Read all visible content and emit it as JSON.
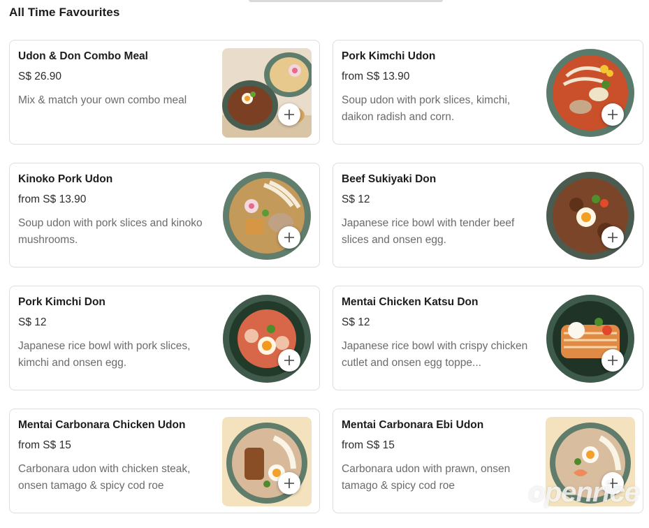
{
  "section": {
    "title": "All Time Favourites"
  },
  "items": [
    {
      "name": "Udon & Don Combo Meal",
      "price": "S$ 26.90",
      "description": "Mix & match your own combo meal",
      "image": "combo-meal-photo"
    },
    {
      "name": "Pork Kimchi Udon",
      "price": "from S$ 13.90",
      "description": "Soup udon with pork slices, kimchi, daikon radish and corn.",
      "image": "pork-kimchi-udon-photo"
    },
    {
      "name": "Kinoko Pork Udon",
      "price": "from S$ 13.90",
      "description": "Soup udon with pork slices and kinoko mushrooms.",
      "image": "kinoko-pork-udon-photo"
    },
    {
      "name": "Beef Sukiyaki Don",
      "price": "S$ 12",
      "description": "Japanese rice bowl with tender beef slices and onsen egg.",
      "image": "beef-sukiyaki-don-photo"
    },
    {
      "name": "Pork Kimchi Don",
      "price": "S$ 12",
      "description": "Japanese rice bowl with pork slices, kimchi and onsen egg.",
      "image": "pork-kimchi-don-photo"
    },
    {
      "name": "Mentai Chicken Katsu Don",
      "price": "S$ 12",
      "description": "Japanese rice bowl with crispy chicken cutlet and onsen egg toppe...",
      "image": "mentai-chicken-katsu-don-photo"
    },
    {
      "name": "Mentai Carbonara Chicken Udon",
      "price": "from S$ 15",
      "description": "Carbonara udon with chicken steak, onsen tamago & spicy cod roe",
      "image": "mentai-carbonara-chicken-udon-photo"
    },
    {
      "name": "Mentai Carbonara Ebi Udon",
      "price": "from S$ 15",
      "description": "Carbonara udon with prawn, onsen tamago & spicy cod roe",
      "image": "mentai-carbonara-ebi-udon-photo"
    }
  ],
  "watermark": {
    "text": "openrice"
  },
  "icons": {
    "add": "plus-icon"
  },
  "colors": {
    "card_border": "#dedede",
    "text_primary": "#1c1c1c",
    "text_secondary": "#6b6b6b"
  }
}
